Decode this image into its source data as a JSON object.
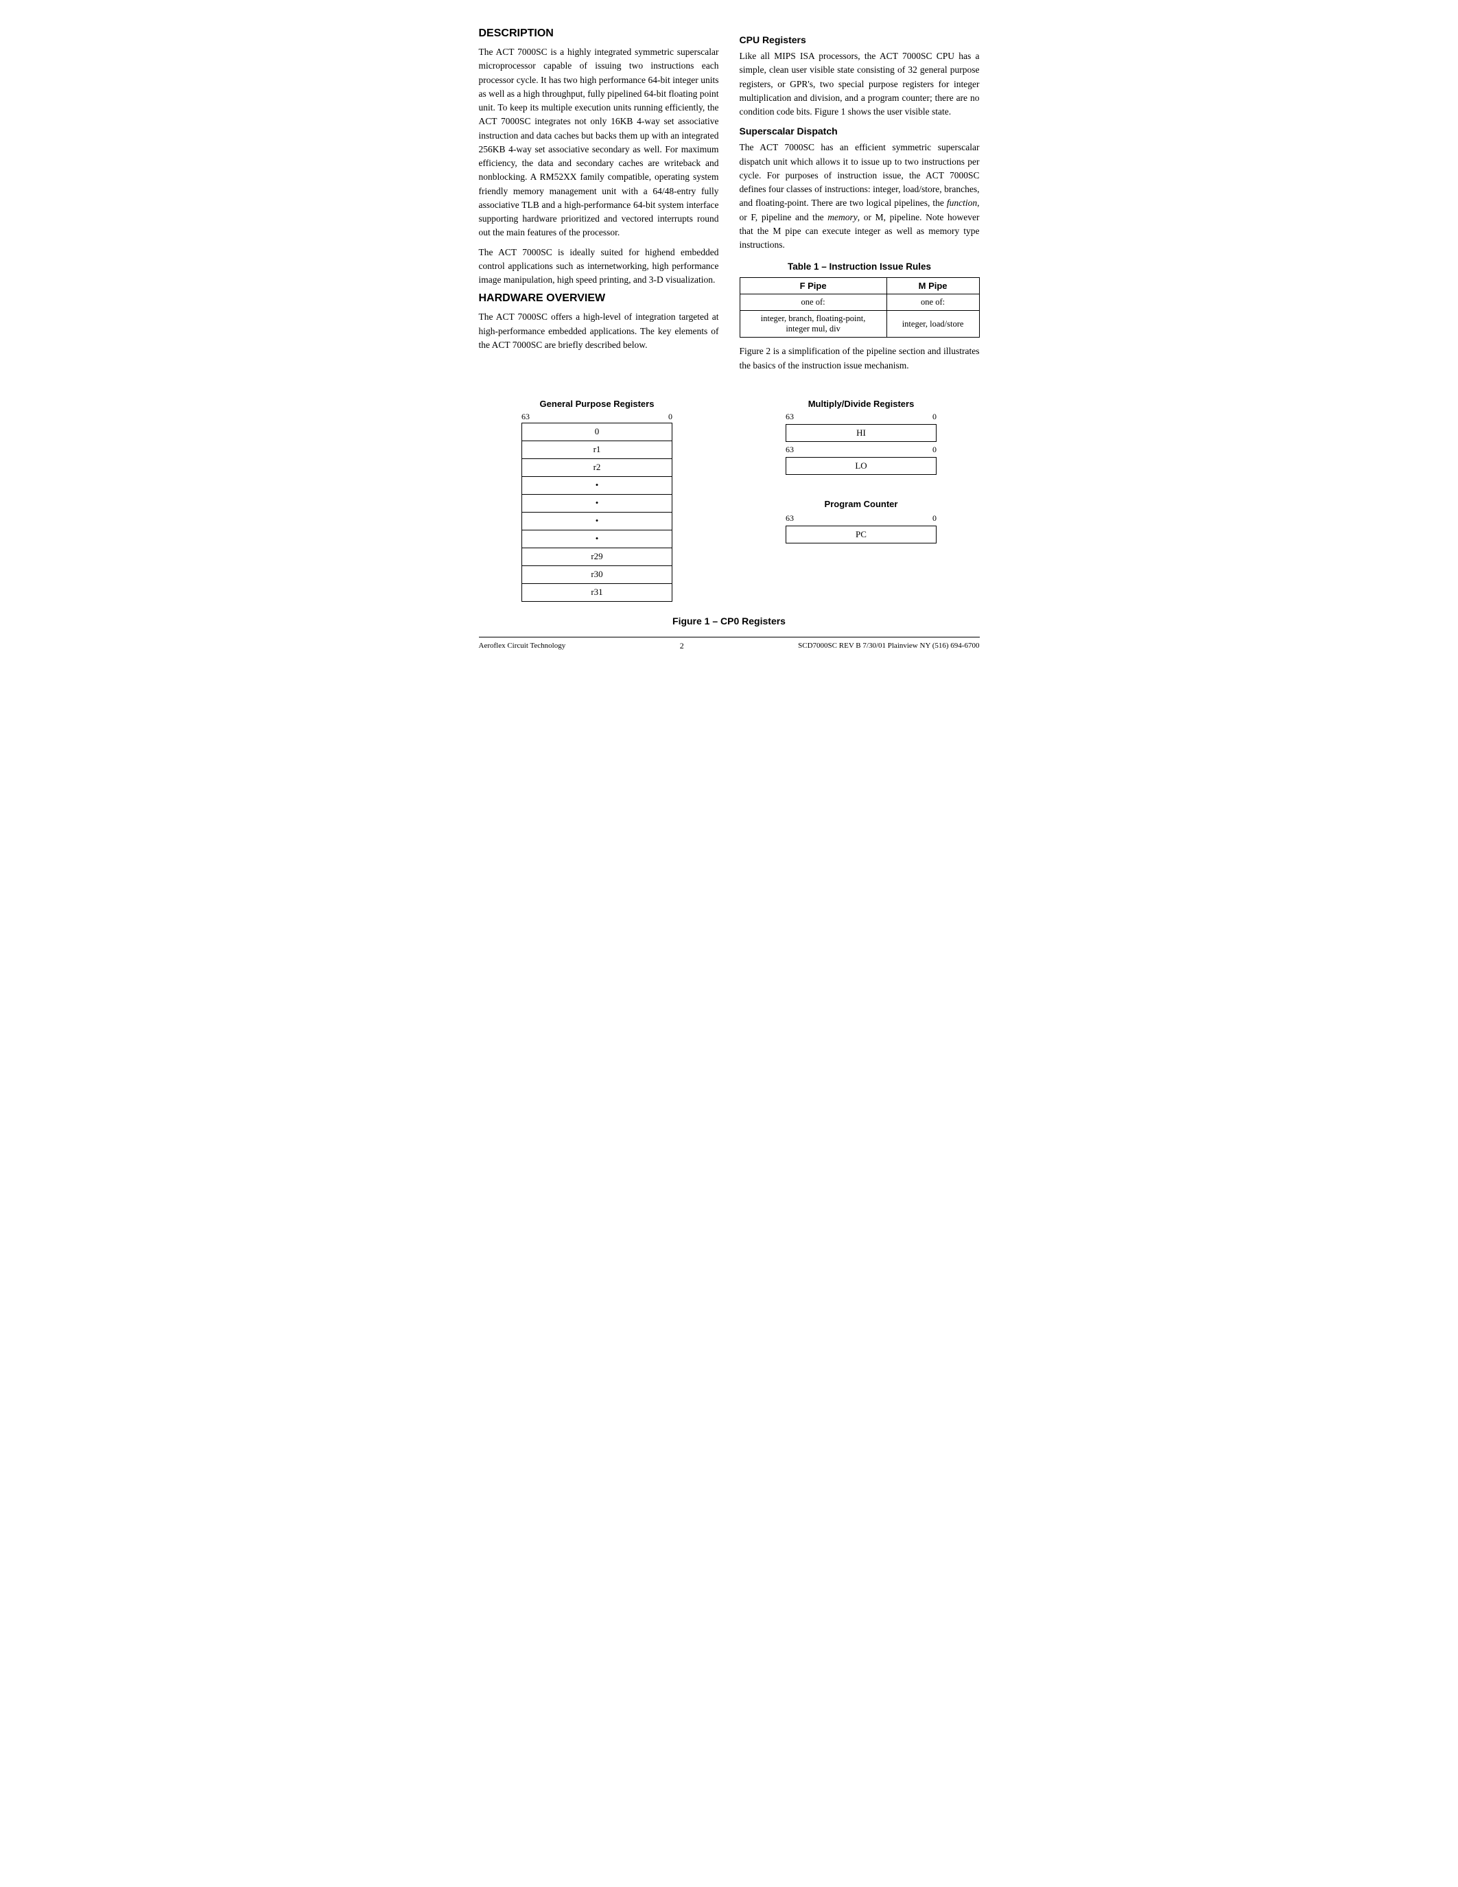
{
  "page": {
    "sections": {
      "description": {
        "title": "DESCRIPTION",
        "paragraphs": [
          "The ACT 7000SC is a highly integrated symmetric superscalar microprocessor capable of issuing two instructions each processor cycle. It has two high performance 64-bit integer units as well as a high throughput, fully pipelined 64-bit floating point unit. To keep its multiple execution units running efficiently, the ACT 7000SC integrates not only 16KB 4-way set associative instruction and data caches but backs them up with an integrated 256KB 4-way set associative secondary as well. For maximum efficiency, the data and secondary caches are writeback and nonblocking. A RM52XX family compatible, operating system friendly memory management unit with a 64/48-entry fully associative TLB and a high-performance 64-bit system interface supporting hardware prioritized and vectored interrupts round out the main features of the processor.",
          "The ACT 7000SC is ideally suited for highend embedded control applications such as internetworking, high performance image manipulation, high speed printing, and 3-D visualization."
        ]
      },
      "hardware_overview": {
        "title": "HARDWARE OVERVIEW",
        "paragraph": "The ACT 7000SC offers a high-level of integration targeted at high-performance embedded applications. The key elements of the ACT 7000SC are briefly described below."
      },
      "cpu_registers": {
        "title": "CPU Registers",
        "paragraph": "Like all MIPS ISA processors, the ACT 7000SC CPU has a simple, clean user visible state consisting of 32 general purpose registers, or GPR's, two special purpose registers for integer multiplication and division, and a program counter; there are no condition code bits. Figure 1 shows the user visible state."
      },
      "superscalar_dispatch": {
        "title": "Superscalar Dispatch",
        "paragraph": "The ACT 7000SC has an efficient symmetric superscalar dispatch unit which allows it to issue up to two instructions per cycle. For purposes of instruction issue, the ACT 7000SC defines four classes of instructions: integer, load/store, branches, and floating-point. There are two logical pipelines, the function, or F, pipeline and the memory, or M, pipeline. Note however that the M pipe can execute integer as well as memory type instructions."
      }
    },
    "table": {
      "title": "Table 1 – Instruction Issue Rules",
      "headers": [
        "F Pipe",
        "M Pipe"
      ],
      "row1": [
        "one of:",
        "one of:"
      ],
      "row2": [
        "integer, branch, floating-point,\ninteger mul, div",
        "integer, load/store"
      ]
    },
    "figure_paragraph": "Figure 2 is a simplification of the pipeline section and illustrates the basics of the instruction issue mechanism.",
    "diagrams": {
      "gpr": {
        "label": "General Purpose Registers",
        "bit_high": "63",
        "bit_low": "0",
        "rows": [
          "0",
          "r1",
          "r2",
          "•",
          "•",
          "•",
          "•",
          "r29",
          "r30",
          "r31"
        ]
      },
      "multiply": {
        "label": "Multiply/Divide Registers",
        "hi_bit_high": "63",
        "hi_bit_low": "0",
        "hi_label": "HI",
        "lo_bit_high": "63",
        "lo_bit_low": "0",
        "lo_label": "LO"
      },
      "program_counter": {
        "label": "Program Counter",
        "bit_high": "63",
        "bit_low": "0",
        "pc_label": "PC"
      }
    },
    "figure_caption": "Figure 1 – CP0 Registers",
    "footer": {
      "left": "Aeroflex Circuit Technology",
      "center": "2",
      "right": "SCD7000SC REV B  7/30/01 Plainview NY (516) 694-6700"
    }
  }
}
